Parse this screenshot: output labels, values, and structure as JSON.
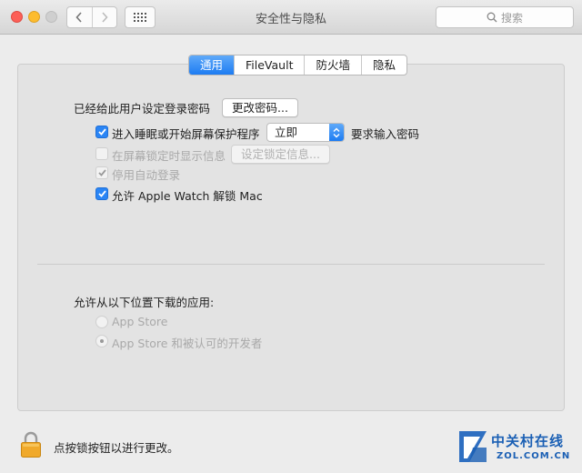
{
  "window": {
    "title": "安全性与隐私",
    "search_placeholder": "搜索"
  },
  "tabs": [
    {
      "label": "通用",
      "active": true
    },
    {
      "label": "FileVault",
      "active": false
    },
    {
      "label": "防火墙",
      "active": false
    },
    {
      "label": "隐私",
      "active": false
    }
  ],
  "general": {
    "password_set_label": "已经给此用户设定登录密码",
    "change_password_button": "更改密码...",
    "sleep_checkbox_label": "进入睡眠或开始屏幕保护程序",
    "sleep_checkbox_checked": true,
    "sleep_delay_value": "立即",
    "require_password_label": "要求输入密码",
    "lock_message_label": "在屏幕锁定时显示信息",
    "lock_message_checked": false,
    "set_lock_message_button": "设定锁定信息...",
    "auto_login_label": "停用自动登录",
    "auto_login_checked": true,
    "apple_watch_label": "允许 Apple Watch 解锁 Mac",
    "apple_watch_checked": true
  },
  "downloads": {
    "heading": "允许从以下位置下载的应用:",
    "options": [
      {
        "label": "App Store",
        "selected": false
      },
      {
        "label": "App Store 和被认可的开发者",
        "selected": true
      }
    ]
  },
  "footer": {
    "lock_text": "点按锁按钮以进行更改。"
  },
  "watermark": {
    "cn": "中关村在线",
    "en": "ZOL.COM.CN"
  },
  "colors": {
    "accent": "#1d7cf2",
    "lock": "#e8a21c",
    "watermark": "#1a5fb4"
  }
}
